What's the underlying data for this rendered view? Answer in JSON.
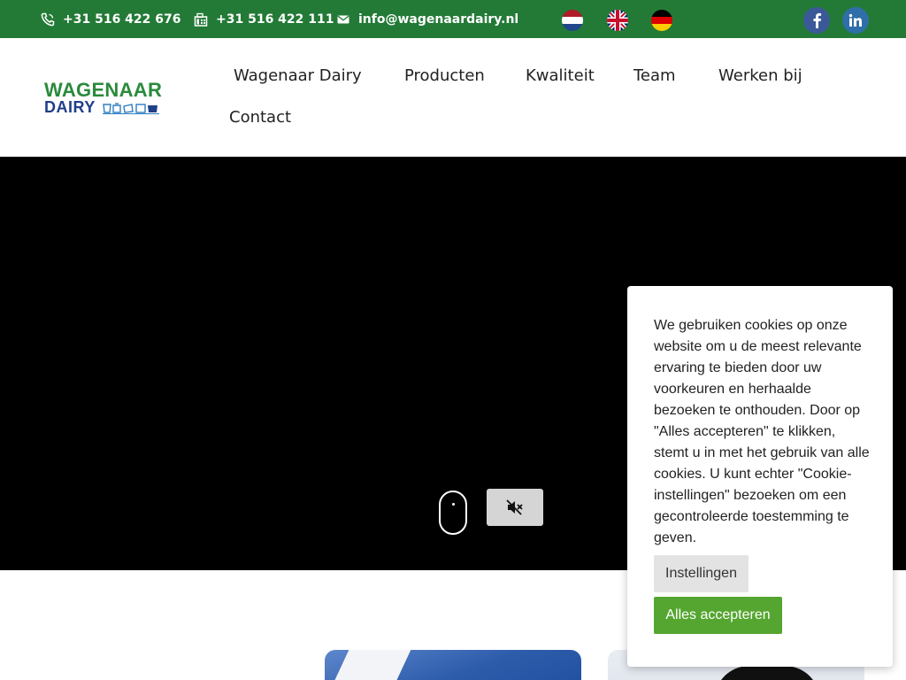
{
  "topbar": {
    "phone": "+31 516 422 676",
    "fax": "+31 516 422 111",
    "email": "info@wagenaardairy.nl",
    "languages": [
      "Nederlands",
      "English",
      "Deutsch"
    ],
    "social": [
      "facebook",
      "linkedin"
    ],
    "bg_color": "#237a36"
  },
  "logo": {
    "line1": "WAGENAAR",
    "line2": "DAIRY"
  },
  "nav": {
    "items": [
      "Wagenaar Dairy",
      "Producten",
      "Kwaliteit",
      "Team",
      "Werken bij",
      "Contact"
    ]
  },
  "hero": {
    "icons": [
      "scroll-mouse-icon",
      "volume-mute-icon"
    ]
  },
  "cookie": {
    "text": "We gebruiken cookies op onze website om u de meest relevante ervaring te bieden door uw voorkeuren en herhaalde bezoeken te onthouden. Door op \"Alles accepteren\" te klikken, stemt u in met het gebruik van alle cookies. U kunt echter \"Cookie-instellingen\" bezoeken om een gecontroleerde toestemming te geven.",
    "settings_label": "Instellingen",
    "accept_label": "Alles accepteren",
    "accept_color": "#55a630"
  }
}
